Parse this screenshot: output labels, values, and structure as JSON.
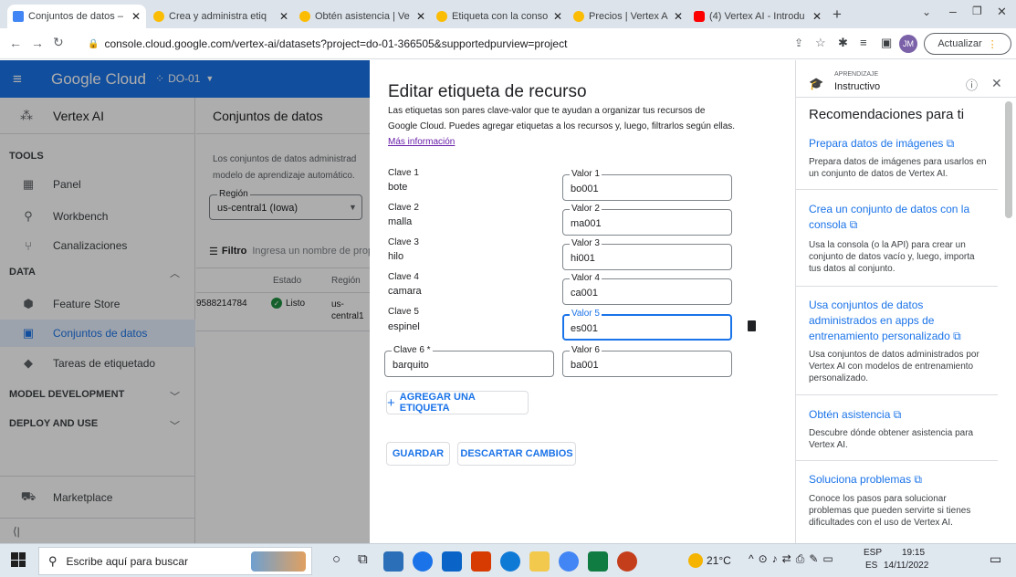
{
  "browser": {
    "tabs": [
      {
        "title": "Conjuntos de datos –",
        "active": true
      },
      {
        "title": "Crea y administra etiq",
        "active": false
      },
      {
        "title": "Obtén asistencia | Ve",
        "active": false
      },
      {
        "title": "Etiqueta con la consol",
        "active": false
      },
      {
        "title": "Precios | Vertex AI |",
        "active": false
      },
      {
        "title": "(4) Vertex AI - Introdu",
        "active": false
      }
    ],
    "url": "console.cloud.google.com/vertex-ai/datasets?project=do-01-366505&supportedpurview=project",
    "update_label": "Actualizar",
    "profile_initials": "JM"
  },
  "header": {
    "brand": "Google Cloud",
    "project": "DO-01"
  },
  "leftnav": {
    "product": "Vertex AI",
    "sections": {
      "tools": "TOOLS",
      "data": "DATA",
      "model_dev": "MODEL DEVELOPMENT",
      "deploy": "DEPLOY AND USE"
    },
    "items": {
      "panel": "Panel",
      "workbench": "Workbench",
      "pipelines": "Canalizaciones",
      "feature_store": "Feature Store",
      "datasets": "Conjuntos de datos",
      "labeling": "Tareas de etiquetado",
      "marketplace": "Marketplace"
    }
  },
  "main": {
    "title": "Conjuntos de datos",
    "desc_line1": "Los conjuntos de datos administrad",
    "desc_line2": "modelo de aprendizaje automático.",
    "region_label": "Región",
    "region_value": "us-central1 (Iowa)",
    "filter_label": "Filtro",
    "filter_placeholder": "Ingresa un nombre de prop",
    "col_status": "Estado",
    "col_region": "Región",
    "row_id": "9588214784",
    "row_status": "Listo",
    "row_region": "us-central1"
  },
  "dialog": {
    "title": "Editar etiqueta de recurso",
    "desc_line1": "Las etiquetas son pares clave-valor que te ayudan a organizar tus recursos de",
    "desc_line2": "Google Cloud. Puedes agregar etiquetas a los recursos y, luego, filtrarlos según ellas.",
    "more_info": "Más información",
    "labels": [
      {
        "key_label": "Clave 1",
        "key": "bote",
        "value_label": "Valor 1",
        "value": "bo001"
      },
      {
        "key_label": "Clave 2",
        "key": "malla",
        "value_label": "Valor 2",
        "value": "ma001"
      },
      {
        "key_label": "Clave 3",
        "key": "hilo",
        "value_label": "Valor 3",
        "value": "hi001"
      },
      {
        "key_label": "Clave 4",
        "key": "camara",
        "value_label": "Valor 4",
        "value": "ca001"
      },
      {
        "key_label": "Clave 5",
        "key": "espinel",
        "value_label": "Valor 5",
        "value": "es001"
      },
      {
        "key_label": "Clave 6 *",
        "key": "barquito",
        "value_label": "Valor 6",
        "value": "ba001"
      }
    ],
    "add_label": "AGREGAR UNA ETIQUETA",
    "save": "GUARDAR",
    "discard": "DESCARTAR CAMBIOS"
  },
  "rpanel": {
    "eyebrow": "APRENDIZAJE",
    "heading": "Instructivo",
    "title": "Recomendaciones para ti",
    "items": [
      {
        "link": "Prepara datos de imágenes",
        "desc": [
          "Prepara datos de imágenes para usarlos en",
          "un conjunto de datos de Vertex AI."
        ]
      },
      {
        "link_lines": [
          "Crea un conjunto de datos con la",
          "consola"
        ],
        "desc": [
          "Usa la consola (o la API) para crear un",
          "conjunto de datos vacío y, luego, importa",
          "tus datos al conjunto."
        ]
      },
      {
        "link_lines": [
          "Usa conjuntos de datos",
          "administrados en apps de",
          "entrenamiento personalizado"
        ],
        "desc": [
          "Usa conjuntos de datos administrados por",
          "Vertex AI con modelos de entrenamiento",
          "personalizado."
        ]
      },
      {
        "link": "Obtén asistencia",
        "desc": [
          "Descubre dónde obtener asistencia para",
          "Vertex AI."
        ]
      },
      {
        "link": "Soluciona problemas",
        "desc": [
          "Conoce los pasos para solucionar",
          "problemas que pueden servirte si tienes",
          "dificultades con el uso de Vertex AI."
        ]
      }
    ]
  },
  "taskbar": {
    "search_placeholder": "Escribe aquí para buscar",
    "temperature": "21°C",
    "lang1": "ESP",
    "lang2": "ES",
    "time": "19:15",
    "date": "14/11/2022"
  },
  "colors": {
    "accent": "#1a73e8",
    "status_green": "#1e8e3e"
  }
}
